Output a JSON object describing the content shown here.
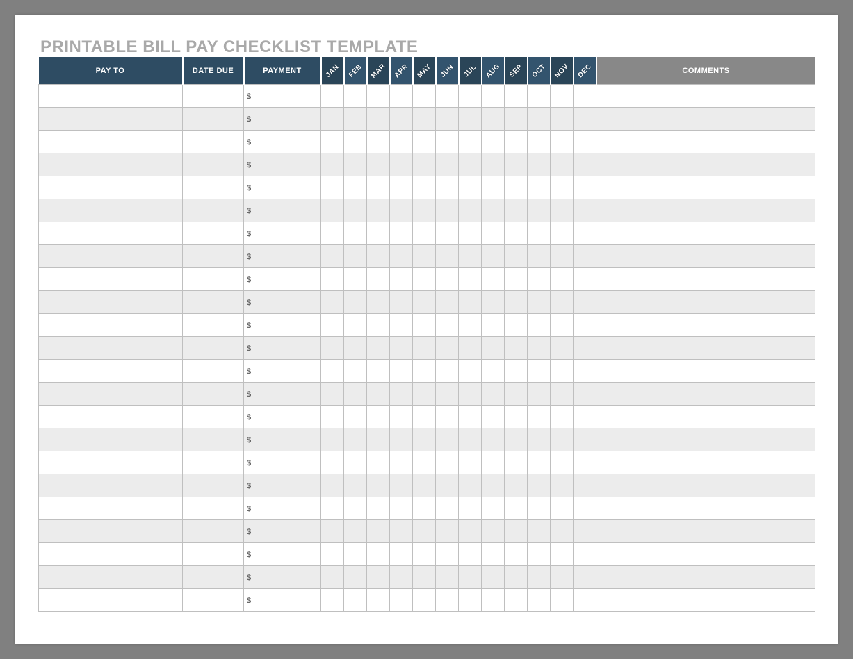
{
  "title": "PRINTABLE BILL PAY CHECKLIST TEMPLATE",
  "headers": {
    "pay_to": "PAY TO",
    "date_due": "DATE DUE",
    "payment": "PAYMENT",
    "comments": "COMMENTS"
  },
  "months": [
    "JAN",
    "FEB",
    "MAR",
    "APR",
    "MAY",
    "JUN",
    "JUL",
    "AUG",
    "SEP",
    "OCT",
    "NOV",
    "DEC"
  ],
  "currency_symbol": "$",
  "row_count": 23,
  "rows": [
    {
      "pay_to": "",
      "date_due": "",
      "payment": "",
      "months": [
        "",
        "",
        "",
        "",
        "",
        "",
        "",
        "",
        "",
        "",
        "",
        ""
      ],
      "comments": ""
    },
    {
      "pay_to": "",
      "date_due": "",
      "payment": "",
      "months": [
        "",
        "",
        "",
        "",
        "",
        "",
        "",
        "",
        "",
        "",
        "",
        ""
      ],
      "comments": ""
    },
    {
      "pay_to": "",
      "date_due": "",
      "payment": "",
      "months": [
        "",
        "",
        "",
        "",
        "",
        "",
        "",
        "",
        "",
        "",
        "",
        ""
      ],
      "comments": ""
    },
    {
      "pay_to": "",
      "date_due": "",
      "payment": "",
      "months": [
        "",
        "",
        "",
        "",
        "",
        "",
        "",
        "",
        "",
        "",
        "",
        ""
      ],
      "comments": ""
    },
    {
      "pay_to": "",
      "date_due": "",
      "payment": "",
      "months": [
        "",
        "",
        "",
        "",
        "",
        "",
        "",
        "",
        "",
        "",
        "",
        ""
      ],
      "comments": ""
    },
    {
      "pay_to": "",
      "date_due": "",
      "payment": "",
      "months": [
        "",
        "",
        "",
        "",
        "",
        "",
        "",
        "",
        "",
        "",
        "",
        ""
      ],
      "comments": ""
    },
    {
      "pay_to": "",
      "date_due": "",
      "payment": "",
      "months": [
        "",
        "",
        "",
        "",
        "",
        "",
        "",
        "",
        "",
        "",
        "",
        ""
      ],
      "comments": ""
    },
    {
      "pay_to": "",
      "date_due": "",
      "payment": "",
      "months": [
        "",
        "",
        "",
        "",
        "",
        "",
        "",
        "",
        "",
        "",
        "",
        ""
      ],
      "comments": ""
    },
    {
      "pay_to": "",
      "date_due": "",
      "payment": "",
      "months": [
        "",
        "",
        "",
        "",
        "",
        "",
        "",
        "",
        "",
        "",
        "",
        ""
      ],
      "comments": ""
    },
    {
      "pay_to": "",
      "date_due": "",
      "payment": "",
      "months": [
        "",
        "",
        "",
        "",
        "",
        "",
        "",
        "",
        "",
        "",
        "",
        ""
      ],
      "comments": ""
    },
    {
      "pay_to": "",
      "date_due": "",
      "payment": "",
      "months": [
        "",
        "",
        "",
        "",
        "",
        "",
        "",
        "",
        "",
        "",
        "",
        ""
      ],
      "comments": ""
    },
    {
      "pay_to": "",
      "date_due": "",
      "payment": "",
      "months": [
        "",
        "",
        "",
        "",
        "",
        "",
        "",
        "",
        "",
        "",
        "",
        ""
      ],
      "comments": ""
    },
    {
      "pay_to": "",
      "date_due": "",
      "payment": "",
      "months": [
        "",
        "",
        "",
        "",
        "",
        "",
        "",
        "",
        "",
        "",
        "",
        ""
      ],
      "comments": ""
    },
    {
      "pay_to": "",
      "date_due": "",
      "payment": "",
      "months": [
        "",
        "",
        "",
        "",
        "",
        "",
        "",
        "",
        "",
        "",
        "",
        ""
      ],
      "comments": ""
    },
    {
      "pay_to": "",
      "date_due": "",
      "payment": "",
      "months": [
        "",
        "",
        "",
        "",
        "",
        "",
        "",
        "",
        "",
        "",
        "",
        ""
      ],
      "comments": ""
    },
    {
      "pay_to": "",
      "date_due": "",
      "payment": "",
      "months": [
        "",
        "",
        "",
        "",
        "",
        "",
        "",
        "",
        "",
        "",
        "",
        ""
      ],
      "comments": ""
    },
    {
      "pay_to": "",
      "date_due": "",
      "payment": "",
      "months": [
        "",
        "",
        "",
        "",
        "",
        "",
        "",
        "",
        "",
        "",
        "",
        ""
      ],
      "comments": ""
    },
    {
      "pay_to": "",
      "date_due": "",
      "payment": "",
      "months": [
        "",
        "",
        "",
        "",
        "",
        "",
        "",
        "",
        "",
        "",
        "",
        ""
      ],
      "comments": ""
    },
    {
      "pay_to": "",
      "date_due": "",
      "payment": "",
      "months": [
        "",
        "",
        "",
        "",
        "",
        "",
        "",
        "",
        "",
        "",
        "",
        ""
      ],
      "comments": ""
    },
    {
      "pay_to": "",
      "date_due": "",
      "payment": "",
      "months": [
        "",
        "",
        "",
        "",
        "",
        "",
        "",
        "",
        "",
        "",
        "",
        ""
      ],
      "comments": ""
    },
    {
      "pay_to": "",
      "date_due": "",
      "payment": "",
      "months": [
        "",
        "",
        "",
        "",
        "",
        "",
        "",
        "",
        "",
        "",
        "",
        ""
      ],
      "comments": ""
    },
    {
      "pay_to": "",
      "date_due": "",
      "payment": "",
      "months": [
        "",
        "",
        "",
        "",
        "",
        "",
        "",
        "",
        "",
        "",
        "",
        ""
      ],
      "comments": ""
    },
    {
      "pay_to": "",
      "date_due": "",
      "payment": "",
      "months": [
        "",
        "",
        "",
        "",
        "",
        "",
        "",
        "",
        "",
        "",
        "",
        ""
      ],
      "comments": ""
    }
  ]
}
